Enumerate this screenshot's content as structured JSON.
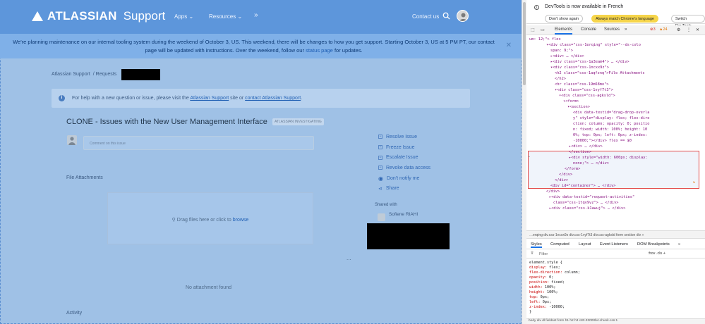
{
  "header": {
    "brand": "ATLASSIAN",
    "product": "Support",
    "apps": "Apps",
    "resources": "Resources",
    "more": "»",
    "contact": "Contact us"
  },
  "banner": {
    "text": "We're planning maintenance on our internal tooling system during the weekend of October 3, US. This weekend, there will be changes to how you get support. Starting October 3, US at 5 PM PT, our contact page will be updated with instructions. Over the weekend, follow our",
    "link": "status page",
    "suffix": " for updates.",
    "close": "✕"
  },
  "breadcrumb": {
    "home": "Atlassian Support",
    "sep": "/",
    "requests": "Requests"
  },
  "info": {
    "prefix": "For help with a new question or issue, please visit the",
    "link1": "Atlassian Support",
    "mid": "site or",
    "link2": "contact Atlassian Support",
    "suffix": "."
  },
  "issue": {
    "title": "CLONE - Issues with the New User Management Interface",
    "status": "ATLASSIAN INVESTIGATING",
    "comment_placeholder": "Comment on this issue"
  },
  "sections": {
    "attachments": "File Attachments",
    "drop_text": "Drag files here or click to",
    "browse": "browse",
    "no_attachment": "No attachment found",
    "more": "...",
    "activity": "Activity"
  },
  "actions": [
    {
      "label": "Resolve Issue",
      "icon": "+"
    },
    {
      "label": "Freeze Issue",
      "icon": "+"
    },
    {
      "label": "Escalate Issue",
      "icon": "+"
    },
    {
      "label": "Revoke data access",
      "icon": "+"
    },
    {
      "label": "Don't notify me",
      "icon": "eye"
    },
    {
      "label": "Share",
      "icon": "share"
    }
  ],
  "shared": {
    "heading": "Shared with",
    "name": "Sofiene RIAHI"
  },
  "devtools": {
    "notice": "DevTools is now available in French",
    "btn1": "Don't show again",
    "btn2": "Always match Chrome's language",
    "btn3": "Switch DevTools",
    "tabs": [
      "Elements",
      "Console",
      "Sources",
      "»"
    ],
    "errors": "3",
    "warnings": "24",
    "dom": [
      "um: 12;\"> flex",
      "▾<div class=\"css-1erqing\" style=\"--ds-colo",
      "  span: 9;\">",
      "  ▸<div> … </div>",
      "  ▸<div class=\"css-1a3eam4\"> … </div>",
      "  ▾<div class=\"css-1ncxx9z\">",
      "     <h2 class=\"css-1aqfznq\">File Attachments",
      "     </h2>",
      "     <hr class=\"css-19m68mo\">",
      "   ▾<div class=\"css-1vyf7t3\">",
      "     ▾<div class=\"css-agksld\">",
      "       ▾<form>",
      "         ▾<section>",
      "            <div data-testid=\"drag-drop-overla",
      "            y\" style=\"display: flex; flex-dire",
      "            ction: column; opacity: 0; positio",
      "            n: fixed; width: 100%; height: 10",
      "            0%; top: 0px; left: 0px; z-index:",
      "            -10000;\"></div> flex == $0",
      "           ▸<div> … </div>",
      "          </section>",
      "         ▸<div style=\"width: 600px; display:",
      "          none;\"> … </div>",
      "        </form>",
      "      </div>",
      "    </div>",
      "    <div id=\"container\"> … </div>",
      "  </div>",
      "  ▸<div data-testid=\"request-activities\"",
      "   class=\"css-1tqv9vz\"> … </div>",
      "  ▸<div class=\"css-k1awuj\"> … </div>"
    ],
    "crumbs": "…erqing  div.css-1ncxx9z  div.css-1vyf7t3  div.css-agksld  form  section  div  »",
    "style_tabs": [
      "Styles",
      "Computed",
      "Layout",
      "Event Listeners",
      "DOM Breakpoints",
      "»"
    ],
    "filter": "Filter",
    "filter_right": ":hov  .cls  +",
    "css": [
      "element.style {",
      "  display: flex;",
      "  flex-direction: column;",
      "  opacity: 0;",
      "  position: fixed;",
      "  width: 100%;",
      "  height: 100%;",
      "  top: 0px;",
      "  left: 0px;",
      "  z-index: -10000;",
      "}"
    ],
    "bottom": "body  div  dl  fieldset  form  h1  h2  h3    c83.33000b4.chunk.css:1"
  },
  "colors": {
    "header": "#5d96db",
    "banner": "#7fb0e8",
    "page": "#9fc1e6",
    "link": "#1f5fb4",
    "highlight": "#e34b4b"
  }
}
